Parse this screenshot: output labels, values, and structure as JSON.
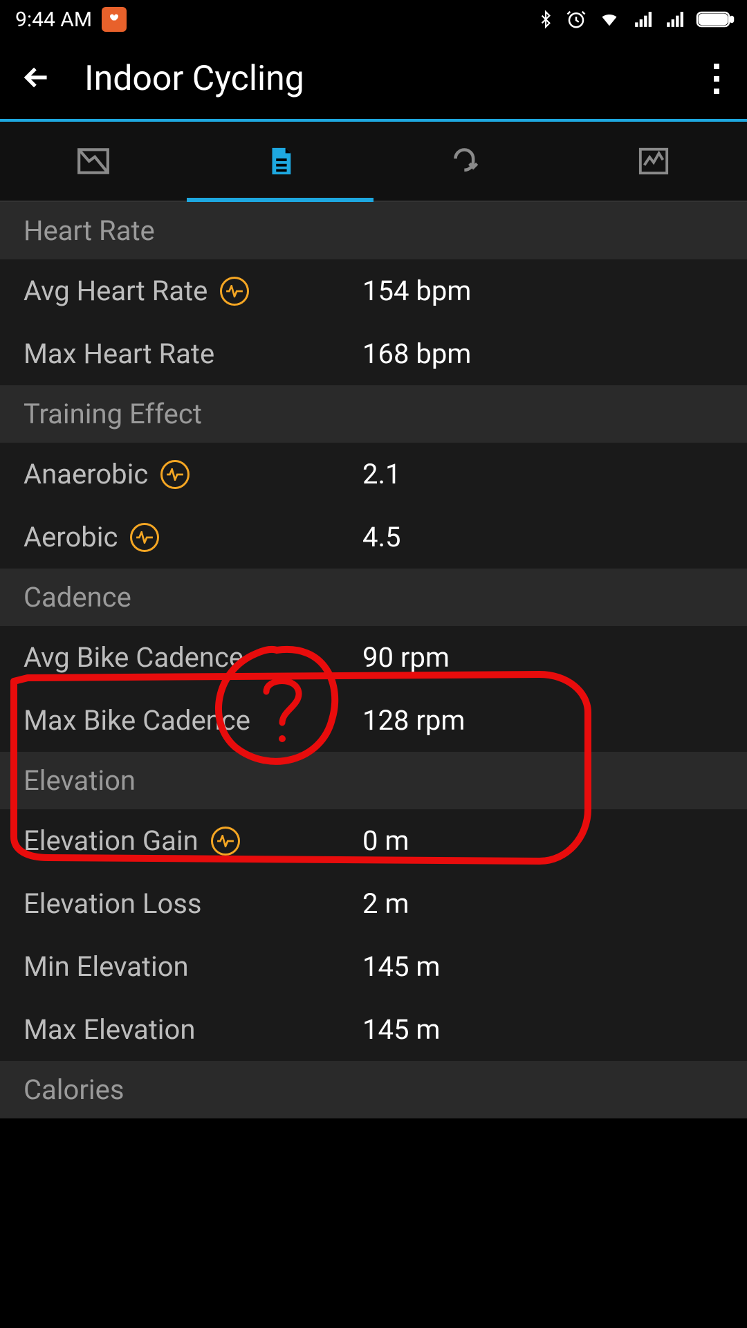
{
  "status": {
    "time": "9:44 AM"
  },
  "header": {
    "title": "Indoor Cycling"
  },
  "sections": [
    {
      "title": "Heart Rate",
      "rows": [
        {
          "label": "Avg Heart Rate",
          "badge": true,
          "value": "154 bpm"
        },
        {
          "label": "Max Heart Rate",
          "badge": false,
          "value": "168 bpm"
        }
      ]
    },
    {
      "title": "Training Effect",
      "rows": [
        {
          "label": "Anaerobic",
          "badge": true,
          "value": "2.1"
        },
        {
          "label": "Aerobic",
          "badge": true,
          "value": "4.5"
        }
      ]
    },
    {
      "title": "Cadence",
      "rows": [
        {
          "label": "Avg Bike Cadence",
          "badge": false,
          "value": "90 rpm"
        },
        {
          "label": "Max Bike Cadence",
          "badge": false,
          "value": "128 rpm"
        }
      ]
    },
    {
      "title": "Elevation",
      "rows": [
        {
          "label": "Elevation Gain",
          "badge": true,
          "value": "0 m"
        },
        {
          "label": "Elevation Loss",
          "badge": false,
          "value": "2 m"
        },
        {
          "label": "Min Elevation",
          "badge": false,
          "value": "145 m"
        },
        {
          "label": "Max Elevation",
          "badge": false,
          "value": "145 m"
        }
      ]
    },
    {
      "title": "Calories",
      "rows": []
    }
  ],
  "annotation": {
    "question_mark": "?"
  }
}
